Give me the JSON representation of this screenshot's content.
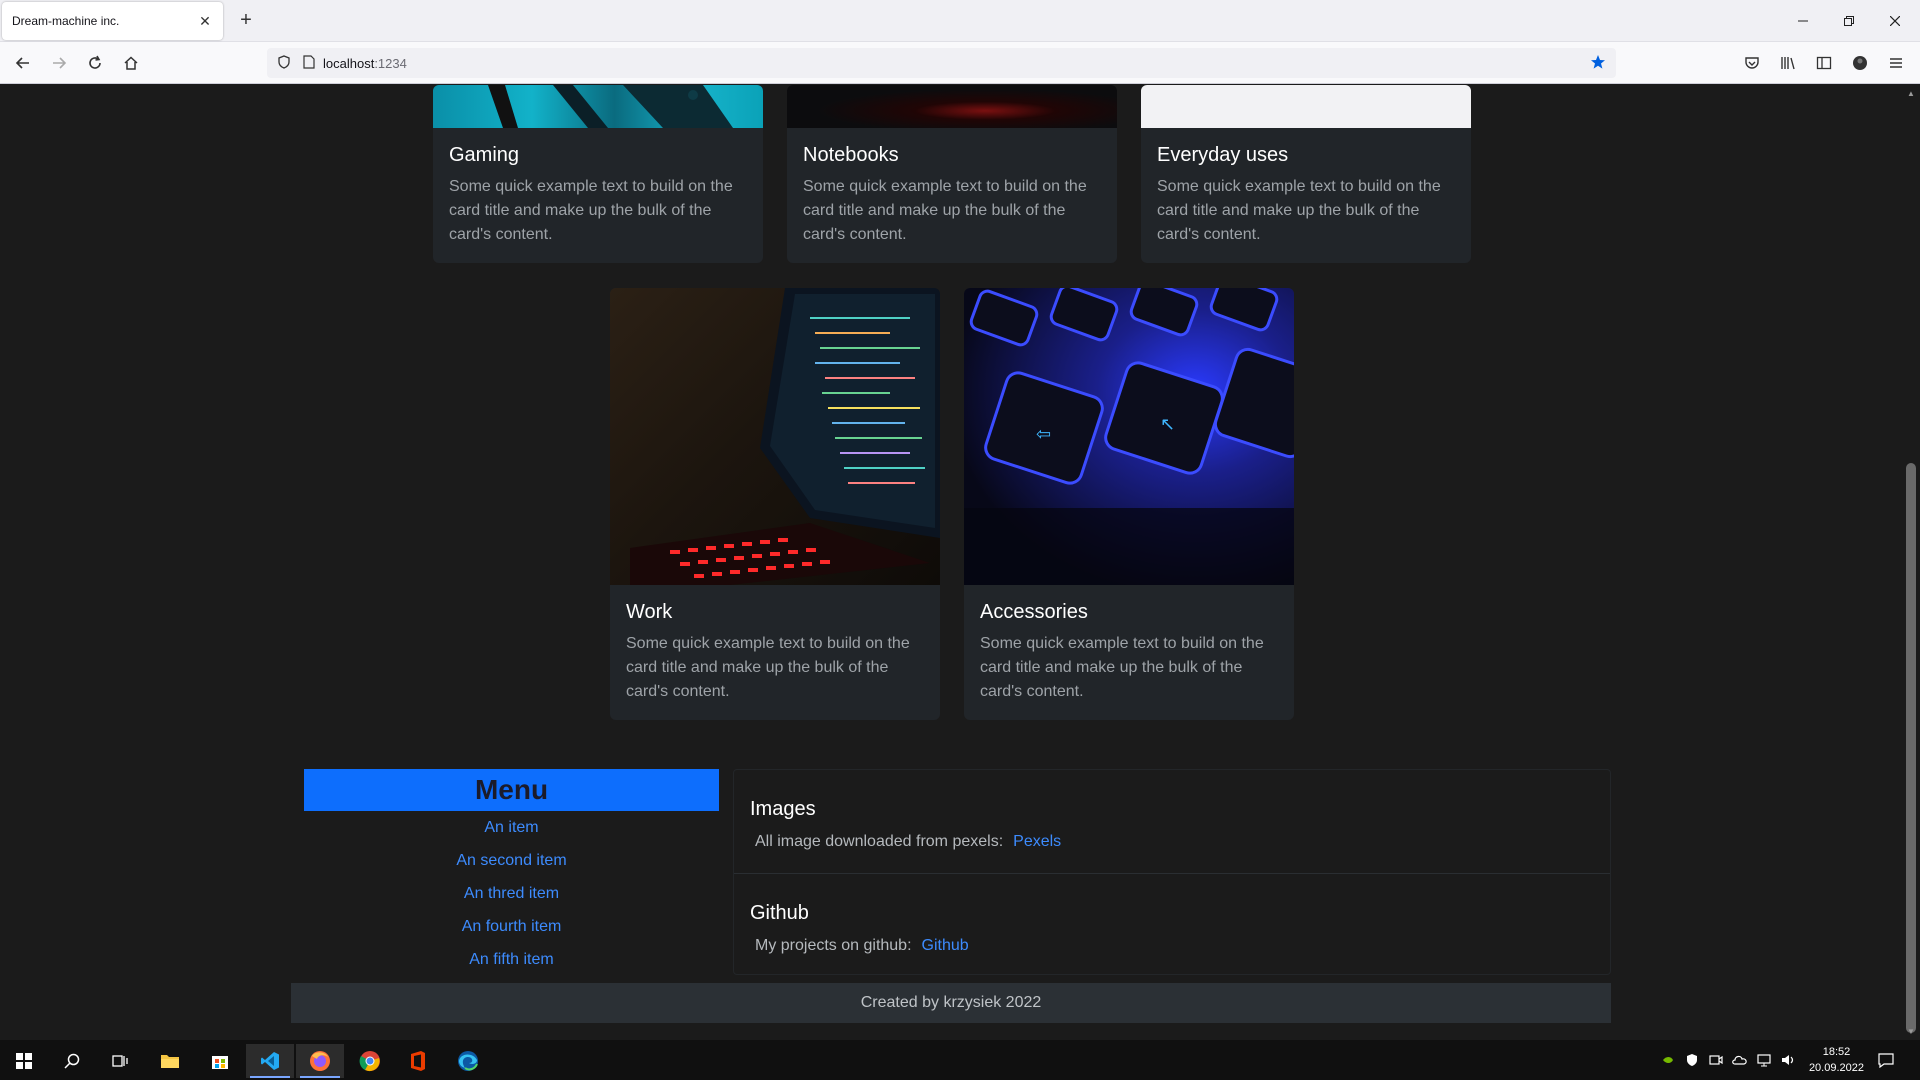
{
  "browser": {
    "tab_title": "Dream-machine inc.",
    "url_host": "localhost",
    "url_port": ":1234"
  },
  "cards_top": [
    {
      "title": "Gaming",
      "text": "Some quick example text to build on the card title and make up the bulk of the card's content."
    },
    {
      "title": "Notebooks",
      "text": "Some quick example text to build on the card title and make up the bulk of the card's content."
    },
    {
      "title": "Everyday uses",
      "text": "Some quick example text to build on the card title and make up the bulk of the card's content."
    }
  ],
  "cards_bottom": [
    {
      "title": "Work",
      "text": "Some quick example text to build on the card title and make up the bulk of the card's content."
    },
    {
      "title": "Accessories",
      "text": "Some quick example text to build on the card title and make up the bulk of the card's content."
    }
  ],
  "menu": {
    "heading": "Menu",
    "items": [
      "An item",
      "An second item",
      "An thred item",
      "An fourth item",
      "An fifth item"
    ]
  },
  "links": {
    "images": {
      "title": "Images",
      "label": "All image downloaded from pexels:",
      "link": "Pexels"
    },
    "github": {
      "title": "Github",
      "label": "My projects on github:",
      "link": "Github"
    }
  },
  "footer": {
    "text": "Created by krzysiek 2022"
  },
  "taskbar": {
    "time": "18:52",
    "date": "20.09.2022"
  },
  "colors": {
    "accent": "#0d6efd",
    "link": "#3d8bfd",
    "card_bg": "#212529",
    "page_bg": "#1b1b1b"
  }
}
